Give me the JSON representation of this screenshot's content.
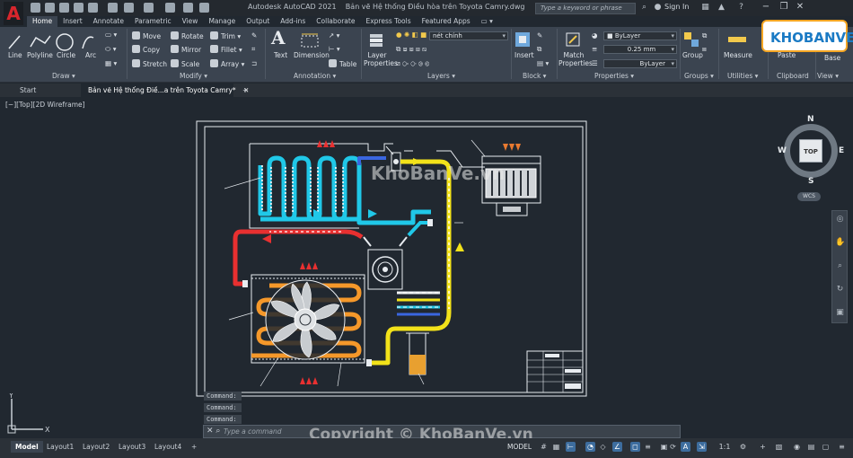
{
  "titlebar": {
    "app_title": "Autodesk AutoCAD 2021",
    "document_title": "Bản vẽ Hệ thống Điều hòa trên Toyota Camry.dwg",
    "search_placeholder": "Type a keyword or phrase",
    "sign_in": "Sign In"
  },
  "ribbon_tabs": [
    "Home",
    "Insert",
    "Annotate",
    "Parametric",
    "View",
    "Manage",
    "Output",
    "Add-ins",
    "Collaborate",
    "Express Tools",
    "Featured Apps"
  ],
  "ribbon": {
    "draw": {
      "label": "Draw",
      "tools": [
        "Line",
        "Polyline",
        "Circle",
        "Arc"
      ]
    },
    "modify": {
      "label": "Modify",
      "tools": [
        "Move",
        "Rotate",
        "Trim",
        "Copy",
        "Mirror",
        "Fillet",
        "Stretch",
        "Scale",
        "Array"
      ]
    },
    "annotation": {
      "label": "Annotation",
      "tools": [
        "Text",
        "Dimension",
        "Table"
      ]
    },
    "layers": {
      "label": "Layers",
      "tool": "Layer Properties",
      "current_layer": "nét chính"
    },
    "block": {
      "label": "Block",
      "tool": "Insert"
    },
    "properties": {
      "label": "Properties",
      "tool": "Match Properties",
      "color": "ByLayer",
      "lineweight": "0.25 mm",
      "linetype": "ByLayer"
    },
    "groups": {
      "label": "Groups",
      "tool": "Group"
    },
    "utilities": {
      "label": "Utilities",
      "tool": "Measure"
    },
    "clipboard": {
      "label": "Clipboard",
      "tool": "Paste"
    },
    "view": {
      "label": "View",
      "tool": "Base"
    }
  },
  "file_tabs": {
    "start": "Start",
    "document": "Bản vẽ Hệ thống Điề...a trên Toyota Camry*"
  },
  "viewport": {
    "label": "[−][Top][2D Wireframe]",
    "viewcube": {
      "face": "TOP",
      "north": "N",
      "south": "S",
      "east": "E",
      "west": "W",
      "wcs": "WCS"
    },
    "ucs": {
      "x": "X",
      "y": "Y"
    }
  },
  "command": {
    "history": [
      "Command:",
      "Command:",
      "Command:"
    ],
    "placeholder": "Type a command"
  },
  "layout_tabs": [
    "Model",
    "Layout1",
    "Layout2",
    "Layout3",
    "Layout4"
  ],
  "status": {
    "space": "MODEL",
    "scale": "1:1"
  },
  "watermarks": {
    "center": "KhoBanVe.vn",
    "bottom": "Copyright © KhoBanVe.vn",
    "logo": "KHOBANVE"
  },
  "colors": {
    "evaporator": "#20c8e8",
    "hot_gas": "#e83030",
    "condenser": "#f5982a",
    "liquid_line": "#f2e21a",
    "low_pressure": "#3a66e0",
    "drawing_lines": "#e8ecf0"
  }
}
